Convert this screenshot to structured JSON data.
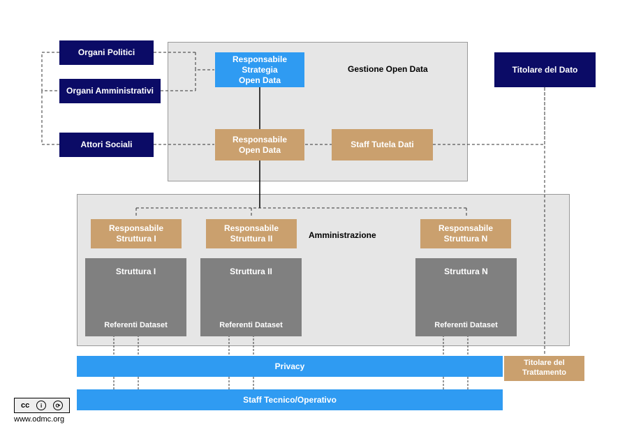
{
  "external": {
    "organi_politici": "Organi Politici",
    "organi_amministrativi": "Organi Amministrativi",
    "attori_sociali": "Attori Sociali",
    "titolare_del_dato": "Titolare del Dato"
  },
  "gestione": {
    "section": "Gestione Open Data",
    "responsabile_strategia": "Responsabile\nStrategia\nOpen Data",
    "responsabile_open_data": "Responsabile\nOpen Data",
    "staff_tutela_dati": "Staff Tutela Dati"
  },
  "amministrazione": {
    "section": "Amministrazione",
    "resp": [
      "Responsabile\nStruttura I",
      "Responsabile\nStruttura II",
      "Responsabile\nStruttura N"
    ],
    "struct_title": [
      "Struttura I",
      "Struttura II",
      "Struttura N"
    ],
    "struct_sub": "Referenti Dataset"
  },
  "bars": {
    "privacy": "Privacy",
    "staff_tecnico": "Staff Tecnico/Operativo",
    "titolare_trattamento": "Titolare del\nTrattamento"
  },
  "footer": {
    "url": "www.odmc.org",
    "cc": "cc"
  }
}
